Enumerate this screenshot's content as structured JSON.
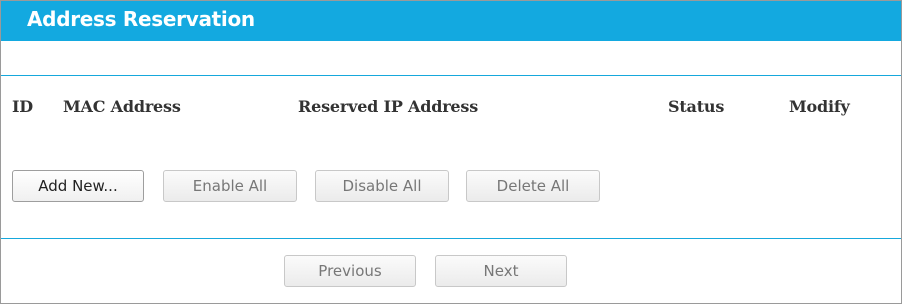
{
  "header": {
    "title": "Address Reservation"
  },
  "table": {
    "columns": [
      {
        "key": "id",
        "label": "ID"
      },
      {
        "key": "mac",
        "label": "MAC Address"
      },
      {
        "key": "ip",
        "label": "Reserved IP Address"
      },
      {
        "key": "status",
        "label": "Status"
      },
      {
        "key": "modify",
        "label": "Modify"
      }
    ],
    "rows": []
  },
  "actions": {
    "add_new": "Add New...",
    "enable_all": "Enable All",
    "disable_all": "Disable All",
    "delete_all": "Delete All"
  },
  "pagination": {
    "previous": "Previous",
    "next": "Next"
  },
  "colors": {
    "accent": "#13a9e0",
    "divider": "#16a8dc"
  }
}
